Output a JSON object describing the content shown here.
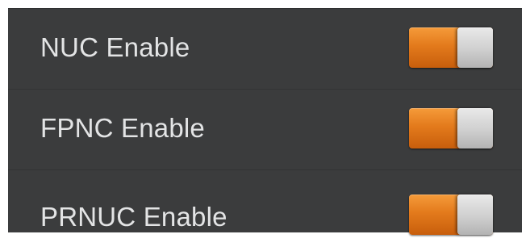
{
  "settings": {
    "items": [
      {
        "label": "NUC Enable",
        "enabled": true
      },
      {
        "label": "FPNC Enable",
        "enabled": true
      },
      {
        "label": "PRNUC Enable",
        "enabled": true
      }
    ]
  },
  "colors": {
    "panel_background": "#3b3c3d",
    "label_text": "#e3e4e5",
    "toggle_on": "#e37a1c",
    "toggle_knob": "#cfcfcf"
  }
}
